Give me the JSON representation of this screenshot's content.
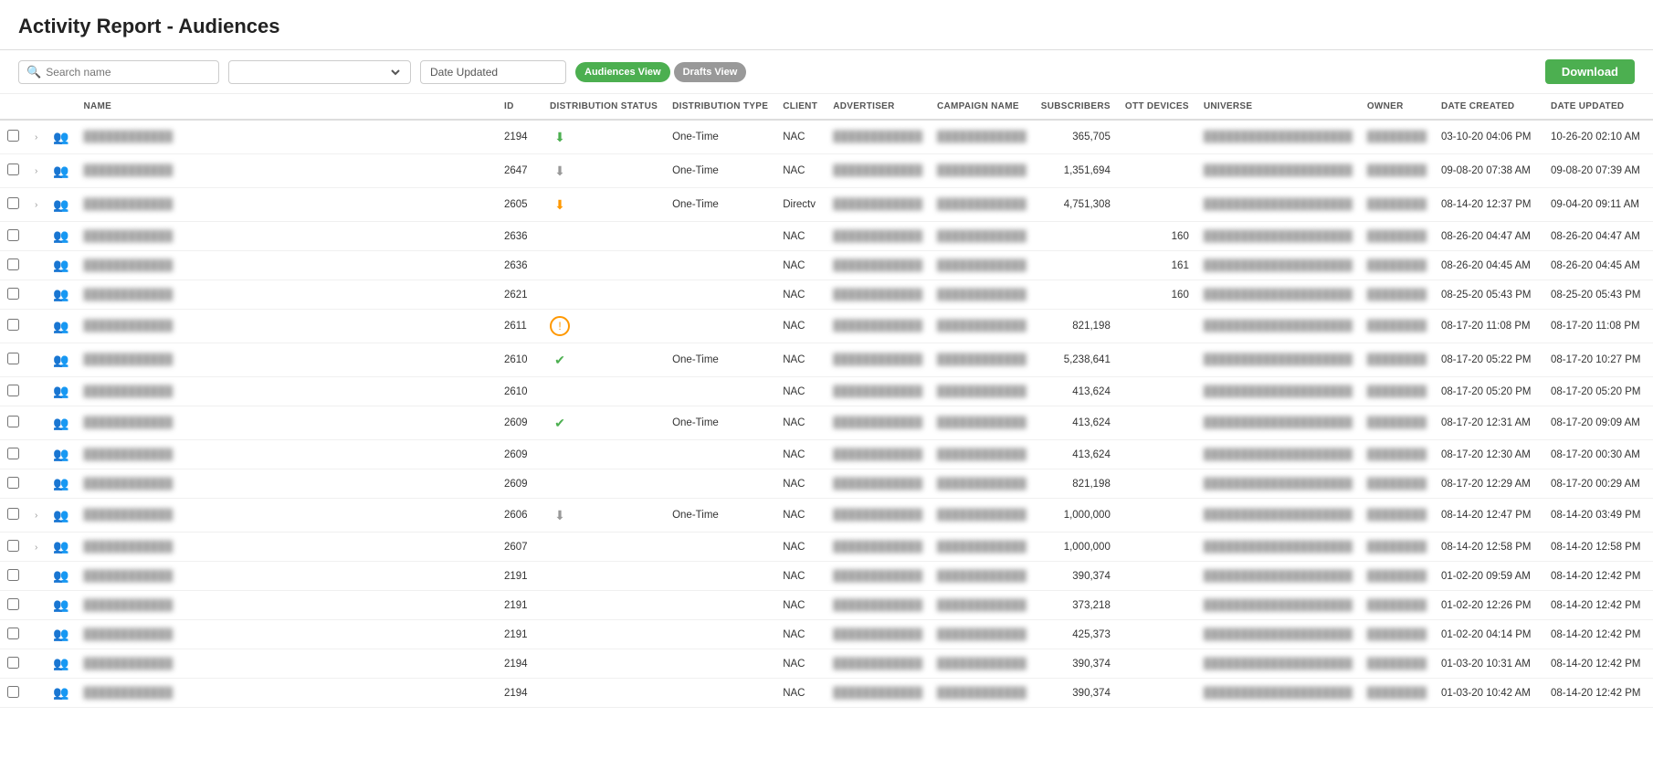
{
  "header": {
    "title": "Activity Report - Audiences"
  },
  "toolbar": {
    "search_placeholder": "Search name",
    "date_field_value": "Date Updated",
    "audiences_view_label": "Audiences View",
    "drafts_view_label": "Drafts View",
    "download_label": "Download",
    "dropdown_placeholder": ""
  },
  "table": {
    "columns": [
      "",
      "",
      "",
      "NAME",
      "ID",
      "DISTRIBUTION STATUS",
      "DISTRIBUTION TYPE",
      "CLIENT",
      "ADVERTISER",
      "CAMPAIGN NAME",
      "SUBSCRIBERS",
      "OTT DEVICES",
      "UNIVERSE",
      "OWNER",
      "DATE CREATED",
      "DATE UPDATED"
    ],
    "rows": [
      {
        "id": "2194",
        "dist_status": "green-down",
        "dist_type": "One-Time",
        "client": "NAC",
        "subscribers": "365,705",
        "ott": "",
        "date_created": "03-10-20 04:06 PM",
        "date_updated": "10-26-20 02:10 AM"
      },
      {
        "id": "2647",
        "dist_status": "gray-down",
        "dist_type": "One-Time",
        "client": "NAC",
        "subscribers": "1,351,694",
        "ott": "",
        "date_created": "09-08-20 07:38 AM",
        "date_updated": "09-08-20 07:39 AM"
      },
      {
        "id": "2605",
        "dist_status": "orange-down",
        "dist_type": "One-Time",
        "client": "Directv",
        "subscribers": "4,751,308",
        "ott": "",
        "date_created": "08-14-20 12:37 PM",
        "date_updated": "09-04-20 09:11 AM"
      },
      {
        "id": "2636",
        "dist_status": "",
        "dist_type": "",
        "client": "NAC",
        "subscribers": "",
        "ott": "160",
        "date_created": "08-26-20 04:47 AM",
        "date_updated": "08-26-20 04:47 AM"
      },
      {
        "id": "2636",
        "dist_status": "",
        "dist_type": "",
        "client": "NAC",
        "subscribers": "",
        "ott": "161",
        "date_created": "08-26-20 04:45 AM",
        "date_updated": "08-26-20 04:45 AM"
      },
      {
        "id": "2621",
        "dist_status": "",
        "dist_type": "",
        "client": "NAC",
        "subscribers": "",
        "ott": "160",
        "date_created": "08-25-20 05:43 PM",
        "date_updated": "08-25-20 05:43 PM"
      },
      {
        "id": "2611",
        "dist_status": "orange-warning",
        "dist_type": "",
        "client": "NAC",
        "subscribers": "821,198",
        "ott": "",
        "date_created": "08-17-20 11:08 PM",
        "date_updated": "08-17-20 11:08 PM"
      },
      {
        "id": "2610",
        "dist_status": "green-check",
        "dist_type": "One-Time",
        "client": "NAC",
        "subscribers": "5,238,641",
        "ott": "",
        "date_created": "08-17-20 05:22 PM",
        "date_updated": "08-17-20 10:27 PM"
      },
      {
        "id": "2610",
        "dist_status": "",
        "dist_type": "",
        "client": "NAC",
        "subscribers": "413,624",
        "ott": "",
        "date_created": "08-17-20 05:20 PM",
        "date_updated": "08-17-20 05:20 PM"
      },
      {
        "id": "2609",
        "dist_status": "green-check",
        "dist_type": "One-Time",
        "client": "NAC",
        "subscribers": "413,624",
        "ott": "",
        "date_created": "08-17-20 12:31 AM",
        "date_updated": "08-17-20 09:09 AM"
      },
      {
        "id": "2609",
        "dist_status": "",
        "dist_type": "",
        "client": "NAC",
        "subscribers": "413,624",
        "ott": "",
        "date_created": "08-17-20 12:30 AM",
        "date_updated": "08-17-20 00:30 AM"
      },
      {
        "id": "2609",
        "dist_status": "",
        "dist_type": "",
        "client": "NAC",
        "subscribers": "821,198",
        "ott": "",
        "date_created": "08-17-20 12:29 AM",
        "date_updated": "08-17-20 00:29 AM"
      },
      {
        "id": "2606",
        "dist_status": "gray-down2",
        "dist_type": "One-Time",
        "client": "NAC",
        "subscribers": "1,000,000",
        "ott": "",
        "date_created": "08-14-20 12:47 PM",
        "date_updated": "08-14-20 03:49 PM"
      },
      {
        "id": "2607",
        "dist_status": "",
        "dist_type": "",
        "client": "NAC",
        "subscribers": "1,000,000",
        "ott": "",
        "date_created": "08-14-20 12:58 PM",
        "date_updated": "08-14-20 12:58 PM"
      },
      {
        "id": "2191",
        "dist_status": "",
        "dist_type": "",
        "client": "NAC",
        "subscribers": "390,374",
        "ott": "",
        "date_created": "01-02-20 09:59 AM",
        "date_updated": "08-14-20 12:42 PM"
      },
      {
        "id": "2191",
        "dist_status": "",
        "dist_type": "",
        "client": "NAC",
        "subscribers": "373,218",
        "ott": "",
        "date_created": "01-02-20 12:26 PM",
        "date_updated": "08-14-20 12:42 PM"
      },
      {
        "id": "2191",
        "dist_status": "",
        "dist_type": "",
        "client": "NAC",
        "subscribers": "425,373",
        "ott": "",
        "date_created": "01-02-20 04:14 PM",
        "date_updated": "08-14-20 12:42 PM"
      },
      {
        "id": "2194",
        "dist_status": "",
        "dist_type": "",
        "client": "NAC",
        "subscribers": "390,374",
        "ott": "",
        "date_created": "01-03-20 10:31 AM",
        "date_updated": "08-14-20 12:42 PM"
      },
      {
        "id": "2194",
        "dist_status": "",
        "dist_type": "",
        "client": "NAC",
        "subscribers": "390,374",
        "ott": "",
        "date_created": "01-03-20 10:42 AM",
        "date_updated": "08-14-20 12:42 PM"
      }
    ]
  }
}
